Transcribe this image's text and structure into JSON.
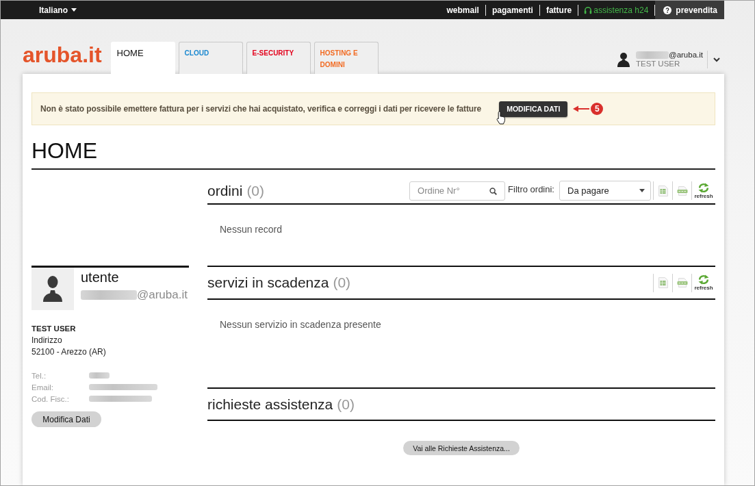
{
  "top_bar": {
    "language": "Italiano",
    "links": [
      {
        "label": "webmail",
        "kind": "link"
      },
      {
        "label": "pagamenti",
        "kind": "link"
      },
      {
        "label": "fatture",
        "kind": "link"
      },
      {
        "label": "assistenza h24",
        "kind": "support"
      },
      {
        "label": "prevendita",
        "kind": "presales"
      }
    ]
  },
  "header": {
    "logo": "aruba.it",
    "tabs": [
      {
        "label": "HOME",
        "selected": true,
        "color": "#111111"
      },
      {
        "label": "CLOUD",
        "selected": false,
        "color": "#1a88d0"
      },
      {
        "label": "E-SECURITY",
        "selected": false,
        "color": "#e3001b"
      },
      {
        "label": "HOSTING E DOMINI",
        "selected": false,
        "color": "#f26a21"
      }
    ],
    "user": {
      "email_domain": "@aruba.it",
      "name": "TEST USER"
    }
  },
  "notice": {
    "message": "Non è stato possibile emettere fattura per i servizi che hai acquistato, verifica e correggi i dati per ricevere le fatture",
    "button": "MODIFICA DATI",
    "step": "5"
  },
  "page_title": "HOME",
  "profile": {
    "title": "utente",
    "email_domain": "@aruba.it",
    "name": "TEST USER",
    "address": [
      "Indirizzo",
      "52100 - Arezzo (AR)"
    ],
    "contacts": [
      {
        "label": "Tel.:"
      },
      {
        "label": "Email:"
      },
      {
        "label": "Cod. Fisc.:"
      }
    ],
    "button": "Modifica Dati"
  },
  "sections": [
    {
      "kind": "orders",
      "title": "ordini",
      "count": "(0)",
      "search": {
        "placeholder": "Ordine Nr°"
      },
      "filter": {
        "label": "Filtro ordini:",
        "value": "Da pagare"
      },
      "tools": [
        {
          "kind": "xls"
        },
        {
          "kind": "csv"
        },
        {
          "kind": "refresh",
          "label": "refresh"
        }
      ],
      "empty_message": "Nessun record"
    },
    {
      "kind": "expiring",
      "title": "servizi in scadenza",
      "count": "(0)",
      "tools": [
        {
          "kind": "xls"
        },
        {
          "kind": "csv"
        },
        {
          "kind": "refresh",
          "label": "refresh"
        }
      ],
      "empty_message": "Nessun servizio in scadenza presente"
    },
    {
      "kind": "support",
      "title": "richieste assistenza",
      "count": "(0)",
      "button": "Vai alle Richieste Assistenza..."
    }
  ]
}
